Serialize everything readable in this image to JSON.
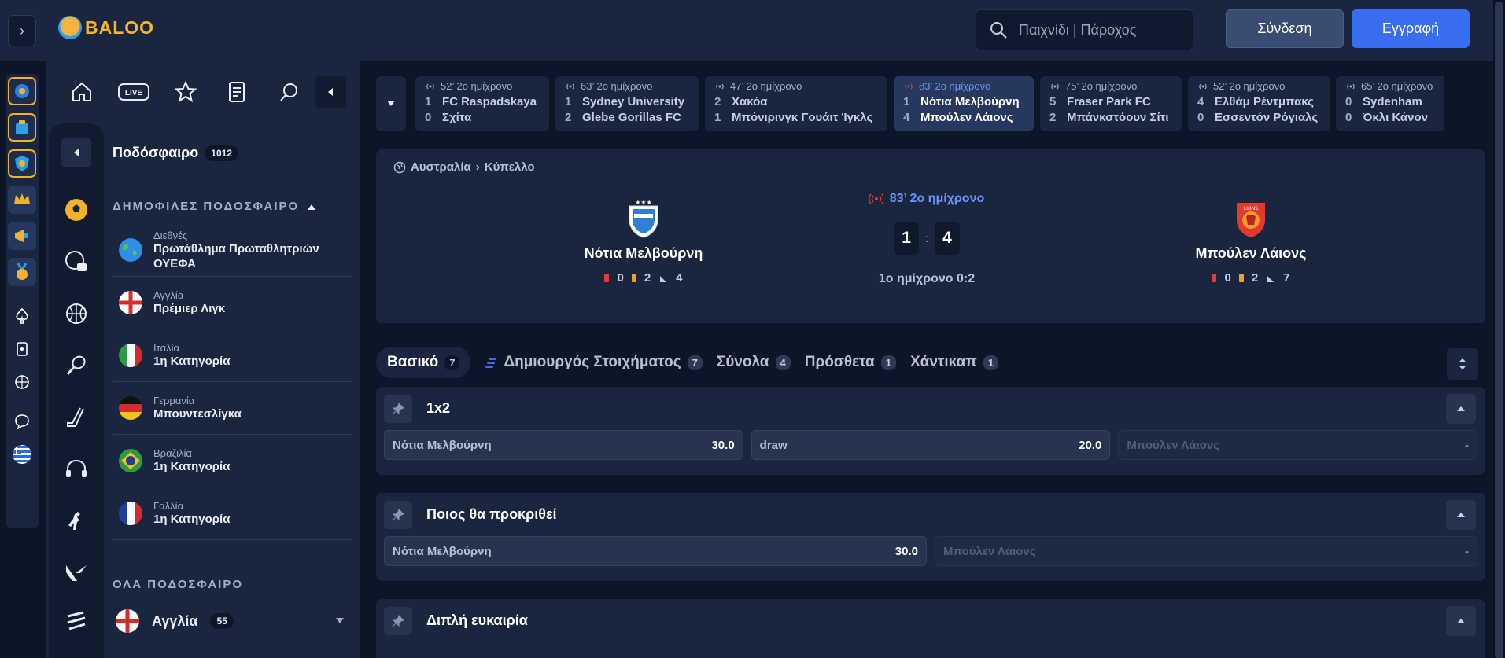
{
  "header": {
    "logo_text": "BALOO",
    "search_placeholder": "Παιχνίδι | Πάροχος",
    "login_label": "Σύνδεση",
    "register_label": "Εγγραφή",
    "accent_color": "#3a6ef2"
  },
  "sidebar": {
    "sport_title": "Ποδόσφαιρο",
    "sport_count": "1012",
    "popular_heading": "ΔΗΜΟΦΙΛΕΣ ΠΟΔΟΣΦΑΙΡΟ",
    "leagues": [
      {
        "country": "Διεθνές",
        "name": "Πρωτάθλημα Πρωταθλητριών ΟΥΕΦΑ",
        "flag": "globe"
      },
      {
        "country": "Αγγλία",
        "name": "Πρέμιερ Λιγκ",
        "flag": "england"
      },
      {
        "country": "Ιταλία",
        "name": "1η Κατηγορία",
        "flag": "italy"
      },
      {
        "country": "Γερμανία",
        "name": "Μπουντεσλίγκα",
        "flag": "germany"
      },
      {
        "country": "Βραζιλία",
        "name": "1η Κατηγορία",
        "flag": "brazil"
      },
      {
        "country": "Γαλλία",
        "name": "1η Κατηγορία",
        "flag": "france"
      }
    ],
    "all_heading": "ΟΛΑ ΠΟΔΟΣΦΑΙΡΟ",
    "all_first": {
      "name": "Αγγλία",
      "count": "55"
    }
  },
  "live_strip": [
    {
      "time": "52’ 2ο ημίχρονο",
      "home_score": "1",
      "home": "FC Raspadskaya",
      "away_score": "0",
      "away": "Σχίτα"
    },
    {
      "time": "63’ 2ο ημίχρονο",
      "home_score": "1",
      "home": "Sydney University",
      "away_score": "2",
      "away": "Glebe Gorillas FC"
    },
    {
      "time": "47’ 2ο ημίχρονο",
      "home_score": "2",
      "home": "Χακόα",
      "away_score": "1",
      "away": "Μπόνιρινγκ Γουάιτ Ίγκλς"
    },
    {
      "time": "83’ 2ο ημίχρονο",
      "home_score": "1",
      "home": "Νότια Μελβούρνη",
      "away_score": "4",
      "away": "Μπούλεν Λάιονς"
    },
    {
      "time": "75’ 2ο ημίχρονο",
      "home_score": "5",
      "home": "Fraser Park FC",
      "away_score": "2",
      "away": "Μπάνκστόουν Σίτι"
    },
    {
      "time": "52’ 2ο ημίχρονο",
      "home_score": "4",
      "home": "Ελθάμ Ρέντμπακς",
      "away_score": "0",
      "away": "Εσσεντόν Ρόγιαλς"
    },
    {
      "time": "65’ 2ο ημίχρονο",
      "home_score": "0",
      "home": "Sydenham",
      "away_score": "0",
      "away": "Όκλι Κάνον"
    }
  ],
  "match": {
    "country": "Αυστραλία",
    "competition": "Κύπελλο",
    "live_time": "83’ 2ο ημίχρονο",
    "home": {
      "name": "Νότια Μελβούρνη",
      "red": "0",
      "yellow": "2",
      "corners": "4"
    },
    "away": {
      "name": "Μπούλεν Λάιονς",
      "red": "0",
      "yellow": "2",
      "corners": "7"
    },
    "home_score": "1",
    "separator": ":",
    "away_score": "4",
    "halftime": "1ο ημίχρονο 0:2"
  },
  "tabs": [
    {
      "label": "Βασικό",
      "count": "7"
    },
    {
      "label": "Δημιουργός Στοιχήματος",
      "count": "7"
    },
    {
      "label": "Σύνολα",
      "count": "4"
    },
    {
      "label": "Πρόσθετα",
      "count": "1"
    },
    {
      "label": "Χάντικαπ",
      "count": "1"
    }
  ],
  "markets": [
    {
      "title": "1x2",
      "odds": [
        {
          "label": "Νότια Μελβούρνη",
          "value": "30.0"
        },
        {
          "label": "draw",
          "value": "20.0"
        },
        {
          "label": "Μπούλεν Λάιονς",
          "value": "-"
        }
      ]
    },
    {
      "title": "Ποιος θα προκριθεί",
      "odds": [
        {
          "label": "Νότια Μελβούρνη",
          "value": "30.0"
        },
        {
          "label": "Μπούλεν Λάιονς",
          "value": "-"
        }
      ]
    },
    {
      "title": "Διπλή ευκαιρία",
      "odds": []
    }
  ]
}
